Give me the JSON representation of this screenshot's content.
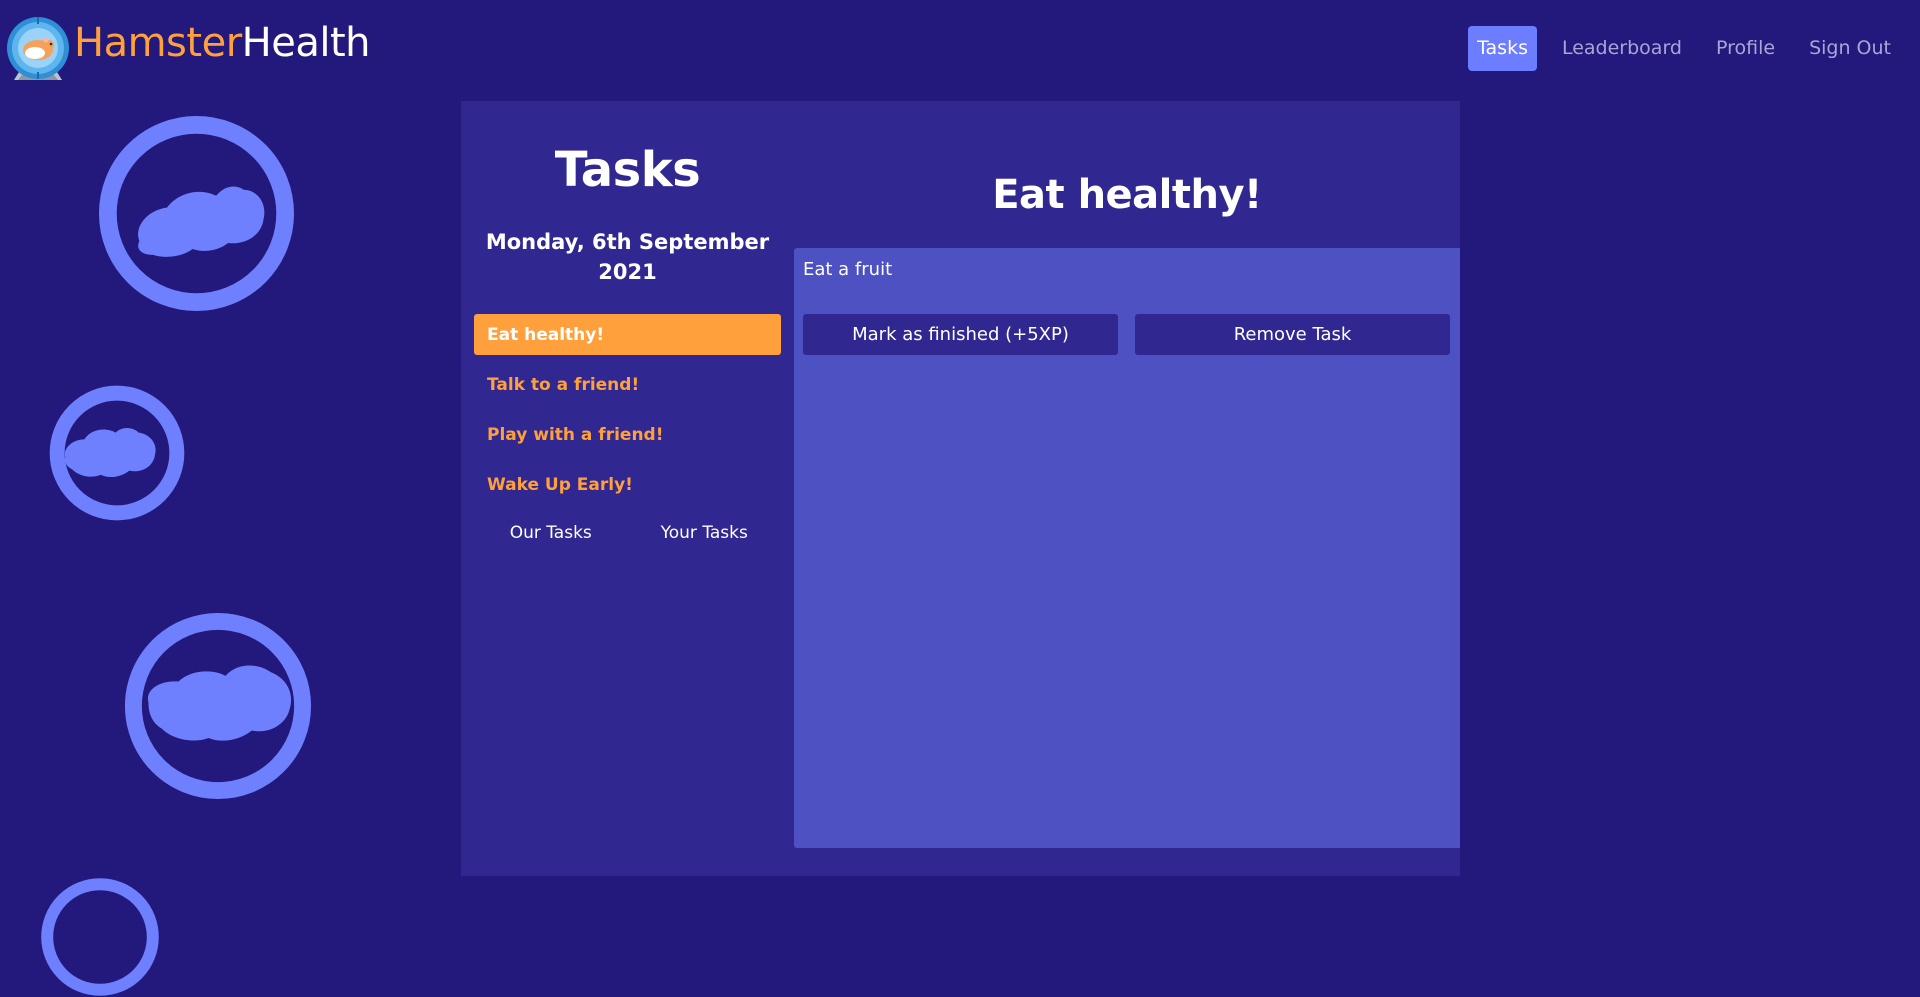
{
  "brand": {
    "part1": "Hamster",
    "part2": "Health"
  },
  "nav": {
    "items": [
      {
        "label": "Tasks",
        "active": true
      },
      {
        "label": "Leaderboard",
        "active": false
      },
      {
        "label": "Profile",
        "active": false
      },
      {
        "label": "Sign Out",
        "active": false
      }
    ]
  },
  "tasks": {
    "title": "Tasks",
    "date": "Monday, 6th September 2021",
    "items": [
      {
        "label": "Eat healthy!",
        "active": true
      },
      {
        "label": "Talk to a friend!",
        "active": false
      },
      {
        "label": "Play with a friend!",
        "active": false
      },
      {
        "label": "Wake Up Early!",
        "active": false
      }
    ],
    "tabs": [
      "Our Tasks",
      "Your Tasks"
    ]
  },
  "detail": {
    "title": "Eat healthy!",
    "description": "Eat a fruit",
    "finish_label": "Mark as finished (+5XP)",
    "remove_label": "Remove Task"
  },
  "colors": {
    "background": "#23187c",
    "panel": "#302791",
    "card": "#4d51c1",
    "accent_orange": "#ffa03d",
    "nav_active": "#6c7dff",
    "wheel": "#6f80ff"
  },
  "icons": {
    "logo": "hamster-wheel-logo-icon",
    "decoration": "hamster-wheel-icon"
  }
}
